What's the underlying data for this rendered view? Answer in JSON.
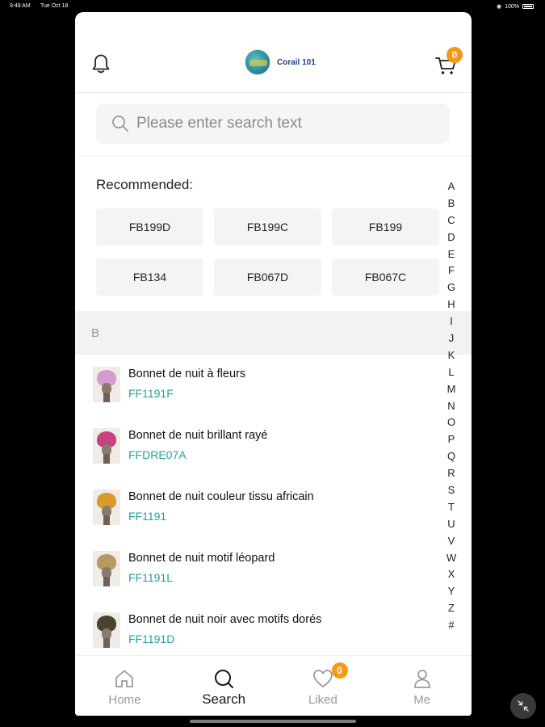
{
  "status_bar": {
    "time": "9:49 AM",
    "date": "Tue Oct 18",
    "battery": "100%"
  },
  "header": {
    "brand_name": "Corail 101",
    "cart_count": "0",
    "icons": [
      "bell-icon",
      "cart-icon"
    ]
  },
  "search": {
    "placeholder": "Please enter search text",
    "value": ""
  },
  "recommended": {
    "title": "Recommended:",
    "chips": [
      "FB199D",
      "FB199C",
      "FB199",
      "FB134",
      "FB067D",
      "FB067C"
    ]
  },
  "section": {
    "letter": "B"
  },
  "products": [
    {
      "name": "Bonnet de nuit à fleurs",
      "code": "FF1191F",
      "thumb_color": "#d59ad1"
    },
    {
      "name": "Bonnet de nuit brillant rayé",
      "code": "FFDRE07A",
      "thumb_color": "#c7427c"
    },
    {
      "name": "Bonnet de nuit couleur tissu africain",
      "code": "FF1191",
      "thumb_color": "#d99a2b"
    },
    {
      "name": "Bonnet de nuit motif léopard",
      "code": "FF1191L",
      "thumb_color": "#b59a63"
    },
    {
      "name": "Bonnet de nuit noir avec motifs dorés",
      "code": "FF1191D",
      "thumb_color": "#4a4330"
    }
  ],
  "alphabet_index": [
    "A",
    "B",
    "C",
    "D",
    "E",
    "F",
    "G",
    "H",
    "I",
    "J",
    "K",
    "L",
    "M",
    "N",
    "O",
    "P",
    "Q",
    "R",
    "S",
    "T",
    "U",
    "V",
    "W",
    "X",
    "Y",
    "Z",
    "#"
  ],
  "tabbar": {
    "tabs": [
      {
        "label": "Home",
        "icon": "home-icon",
        "active": false
      },
      {
        "label": "Search",
        "icon": "search-icon",
        "active": true
      },
      {
        "label": "Liked",
        "icon": "heart-icon",
        "active": false
      },
      {
        "label": "Me",
        "icon": "user-icon",
        "active": false
      }
    ],
    "liked_count": "0"
  },
  "colors": {
    "accent_badge": "#f59a16",
    "product_code": "#22a39a",
    "brand_text": "#1c3d8f"
  }
}
